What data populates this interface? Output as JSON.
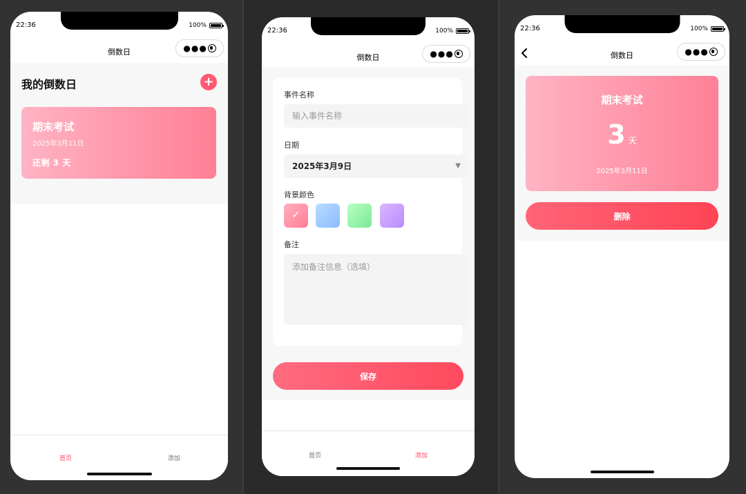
{
  "status_bar": {
    "time": "22:36",
    "battery": "100%"
  },
  "colors": {
    "accent": "#ff4d6a",
    "card_start": "#ffb3c4",
    "card_end": "#ff8095",
    "background": "#f7f7f7"
  },
  "screen1": {
    "nav_title": "倒数日",
    "page_title": "我的倒数日",
    "add_icon": "+",
    "card": {
      "name": "期末考试",
      "date": "2025年3月11日",
      "remaining": "还剩 3 天"
    },
    "tabs": [
      {
        "label": "首页",
        "active": true
      },
      {
        "label": "添加",
        "active": false
      }
    ]
  },
  "screen2": {
    "nav_title": "倒数日",
    "form": {
      "name_label": "事件名称",
      "name_placeholder": "输入事件名称",
      "date_label": "日期",
      "date_value": "2025年3月9日",
      "color_label": "背景颜色",
      "colors": [
        "pink",
        "blue",
        "green",
        "purple"
      ],
      "selected_color": "pink",
      "check_mark": "✓",
      "note_label": "备注",
      "note_placeholder": "添加备注信息（选填）"
    },
    "save_label": "保存",
    "tabs": [
      {
        "label": "首页",
        "active": false
      },
      {
        "label": "添加",
        "active": true
      }
    ]
  },
  "screen3": {
    "nav_title": "倒数日",
    "event_name": "期末考试",
    "count": "3",
    "unit": "天",
    "date": "2025年3月11日",
    "delete_label": "删除"
  }
}
